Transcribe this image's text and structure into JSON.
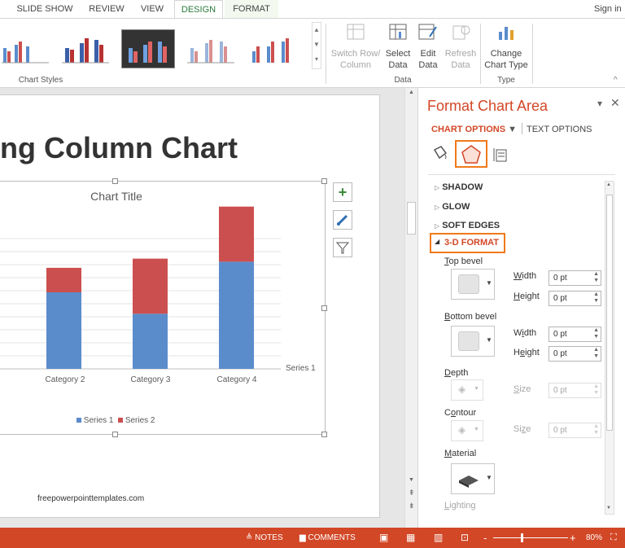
{
  "tabs": [
    {
      "label": "SLIDE SHOW"
    },
    {
      "label": "REVIEW"
    },
    {
      "label": "VIEW"
    },
    {
      "label": "DESIGN"
    },
    {
      "label": "FORMAT"
    }
  ],
  "signin": "Sign in",
  "ribbon": {
    "chart_styles_label": "Chart Styles",
    "switch_row_col": "Switch Row/ Column",
    "select_data": "Select Data",
    "edit_data": "Edit Data",
    "refresh_data": "Refresh Data",
    "data_group": "Data",
    "change_chart_type": "Change Chart Type",
    "type_group": "Type"
  },
  "slide": {
    "title": "ng Column Chart",
    "chart_title": "Chart Title",
    "categories": [
      "Category 2",
      "Category 3",
      "Category 4"
    ],
    "series_label": "Series 1",
    "legend": [
      {
        "name": "Series 1",
        "color": "#5a8ccc"
      },
      {
        "name": "Series 2",
        "color": "#cc4f4f"
      }
    ],
    "footer": "freepowerpointtemplates.com"
  },
  "chart_data": {
    "type": "bar",
    "title": "Chart Title",
    "categories": [
      "Category 2",
      "Category 3",
      "Category 4"
    ],
    "series": [
      {
        "name": "Series 1",
        "values": [
          2.5,
          1.8,
          3.5
        ]
      },
      {
        "name": "Series 2",
        "values": [
          0.8,
          1.8,
          1.8
        ]
      }
    ]
  },
  "pane": {
    "title": "Format Chart Area",
    "chart_options": "CHART OPTIONS",
    "text_options": "TEXT OPTIONS",
    "shadow": "SHADOW",
    "glow": "GLOW",
    "soft_edges": "SOFT EDGES",
    "format3d": "3-D FORMAT",
    "top_bevel": "Top bevel",
    "bottom_bevel": "Bottom bevel",
    "width": "Width",
    "height": "Height",
    "top_width": "0 pt",
    "top_height": "0 pt",
    "bot_width": "0 pt",
    "bot_height": "0 pt",
    "depth": "Depth",
    "size": "Size",
    "depth_size": "0 pt",
    "contour": "Contour",
    "contour_size": "0 pt",
    "material": "Material",
    "lighting": "Lighting"
  },
  "status": {
    "notes": "NOTES",
    "comments": "COMMENTS",
    "zoom": "80%"
  },
  "colors": {
    "accent": "#d24726",
    "series1": "#5a8ccc",
    "series2": "#cc4f4f"
  }
}
